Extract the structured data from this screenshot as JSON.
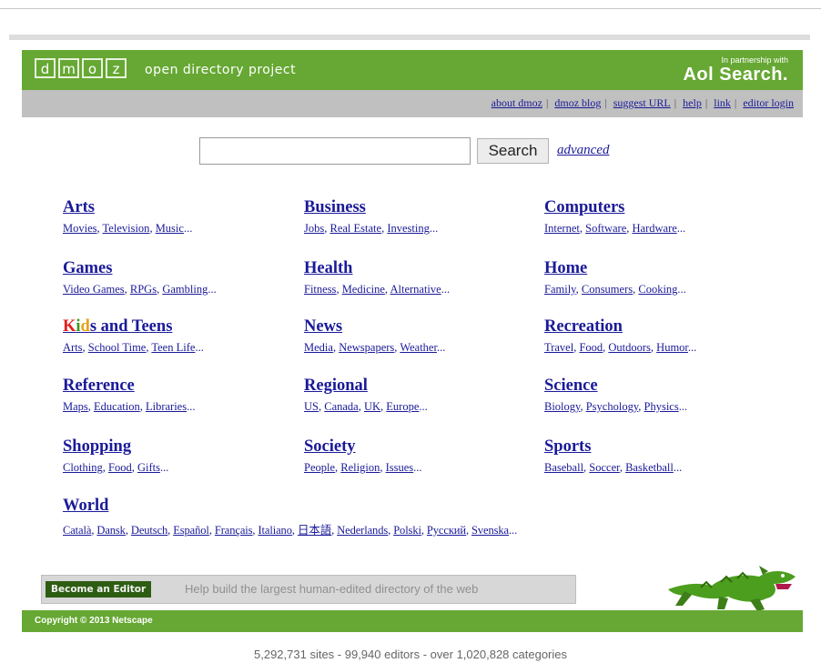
{
  "header": {
    "logo_letters": [
      "d",
      "m",
      "o",
      "z"
    ],
    "logo_text": "open directory project",
    "partner_small": "In partnership with",
    "partner_brand": "Aol Search."
  },
  "topnav": [
    "about dmoz",
    "dmoz blog",
    "suggest URL",
    "help",
    "link",
    "editor login"
  ],
  "search": {
    "button": "Search",
    "advanced": "advanced",
    "value": ""
  },
  "categories": [
    {
      "title": "Arts",
      "subs": [
        "Movies",
        "Television",
        "Music"
      ]
    },
    {
      "title": "Business",
      "subs": [
        "Jobs",
        "Real Estate",
        "Investing"
      ]
    },
    {
      "title": "Computers",
      "subs": [
        "Internet",
        "Software",
        "Hardware"
      ]
    },
    {
      "title": "Games",
      "subs": [
        "Video Games",
        "RPGs",
        "Gambling"
      ]
    },
    {
      "title": "Health",
      "subs": [
        "Fitness",
        "Medicine",
        "Alternative"
      ]
    },
    {
      "title": "Home",
      "subs": [
        "Family",
        "Consumers",
        "Cooking"
      ]
    },
    {
      "title": "Kids and Teens",
      "subs": [
        "Arts",
        "School Time",
        "Teen Life"
      ]
    },
    {
      "title": "News",
      "subs": [
        "Media",
        "Newspapers",
        "Weather"
      ]
    },
    {
      "title": "Recreation",
      "subs": [
        "Travel",
        "Food",
        "Outdoors",
        "Humor"
      ]
    },
    {
      "title": "Reference",
      "subs": [
        "Maps",
        "Education",
        "Libraries"
      ]
    },
    {
      "title": "Regional",
      "subs": [
        "US",
        "Canada",
        "UK",
        "Europe"
      ]
    },
    {
      "title": "Science",
      "subs": [
        "Biology",
        "Psychology",
        "Physics"
      ]
    },
    {
      "title": "Shopping",
      "subs": [
        "Clothing",
        "Food",
        "Gifts"
      ]
    },
    {
      "title": "Society",
      "subs": [
        "People",
        "Religion",
        "Issues"
      ]
    },
    {
      "title": "Sports",
      "subs": [
        "Baseball",
        "Soccer",
        "Basketball"
      ]
    },
    {
      "title": "World",
      "subs": [
        "Català",
        "Dansk",
        "Deutsch",
        "Español",
        "Français",
        "Italiano",
        "日本語",
        "Nederlands",
        "Polski",
        "Русский",
        "Svenska"
      ]
    }
  ],
  "kids_letter_colors": [
    "#e0201b",
    "#3a9a1c",
    "#e6a017",
    "#1a1a99"
  ],
  "editor": {
    "button": "Become an Editor",
    "text": "Help build the largest human-edited directory of the web"
  },
  "footer": {
    "copyright": "Copyright © 2013 Netscape"
  },
  "stats": "5,292,731 sites - 99,940 editors - over 1,020,828 categories",
  "colors": {
    "green": "#66a833",
    "link": "#1a1a99",
    "grey_bar": "#c0c0c0"
  }
}
